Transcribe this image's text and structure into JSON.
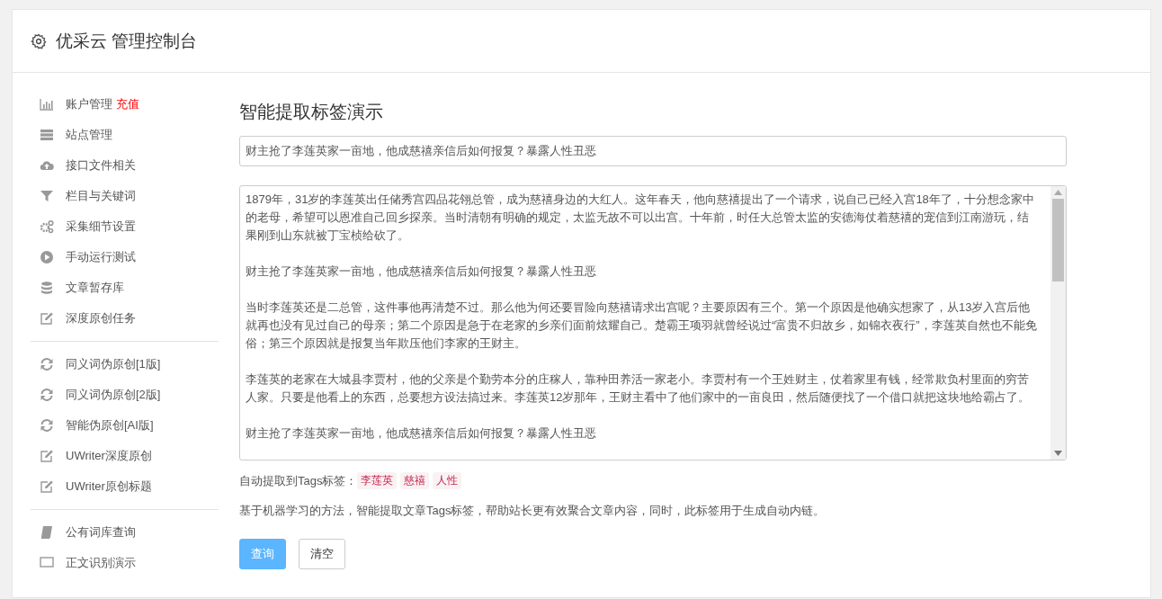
{
  "header": {
    "title": "优采云 管理控制台"
  },
  "sidebar": {
    "groups": [
      [
        {
          "kind": "chart",
          "label": "账户管理",
          "badge": "充值"
        },
        {
          "kind": "server",
          "label": "站点管理"
        },
        {
          "kind": "cloud",
          "label": "接口文件相关"
        },
        {
          "kind": "filter",
          "label": "栏目与关键词"
        },
        {
          "kind": "gears",
          "label": "采集细节设置"
        },
        {
          "kind": "play",
          "label": "手动运行测试"
        },
        {
          "kind": "database",
          "label": "文章暂存库"
        },
        {
          "kind": "edit",
          "label": "深度原创任务"
        }
      ],
      [
        {
          "kind": "refresh",
          "label": "同义词伪原创[1版]"
        },
        {
          "kind": "refresh",
          "label": "同义词伪原创[2版]"
        },
        {
          "kind": "refresh",
          "label": "智能伪原创[AI版]"
        },
        {
          "kind": "edit",
          "label": "UWriter深度原创"
        },
        {
          "kind": "edit",
          "label": "UWriter原创标题"
        }
      ],
      [
        {
          "kind": "book",
          "label": "公有词库查询"
        },
        {
          "kind": "monitor",
          "label": "正文识别演示"
        }
      ]
    ]
  },
  "main": {
    "title": "智能提取标签演示",
    "title_field": {
      "value": "财主抢了李莲英家一亩地，他成慈禧亲信后如何报复？暴露人性丑恶"
    },
    "article": [
      "1879年，31岁的李莲英出任储秀宫四品花翎总管，成为慈禧身边的大红人。这年春天，他向慈禧提出了一个请求，说自己已经入宫18年了，十分想念家中的老母，希望可以恩准自己回乡探亲。当时清朝有明确的规定，太监无故不可以出宫。十年前，时任大总管太监的安德海仗着慈禧的宠信到江南游玩，结果刚到山东就被丁宝桢给砍了。",
      "财主抢了李莲英家一亩地，他成慈禧亲信后如何报复？暴露人性丑恶",
      "当时李莲英还是二总管，这件事他再清楚不过。那么他为何还要冒险向慈禧请求出宫呢？主要原因有三个。第一个原因是他确实想家了，从13岁入宫后他就再也没有见过自己的母亲；第二个原因是急于在老家的乡亲们面前炫耀自己。楚霸王项羽就曾经说过“富贵不归故乡，如锦衣夜行”，李莲英自然也不能免俗；第三个原因就是报复当年欺压他们李家的王财主。",
      "李莲英的老家在大城县李贾村，他的父亲是个勤劳本分的庄稼人，靠种田养活一家老小。李贾村有一个王姓财主，仗着家里有钱，经常欺负村里面的穷苦人家。只要是他看上的东西，总要想方设法搞过来。李莲英12岁那年，王财主看中了他们家中的一亩良田，然后随便找了一个借口就把这块地给霸占了。",
      "财主抢了李莲英家一亩地，他成慈禧亲信后如何报复？暴露人性丑恶"
    ],
    "tags_label": "自动提取到Tags标签：",
    "tags": [
      "李莲英",
      "慈禧",
      "人性"
    ],
    "description": "基于机器学习的方法，智能提取文章Tags标签，帮助站长更有效聚合文章内容，同时，此标签用于生成自动内链。",
    "buttons": [
      {
        "label": "查询",
        "kind": "primary"
      },
      {
        "label": "清空",
        "kind": "default"
      }
    ]
  }
}
